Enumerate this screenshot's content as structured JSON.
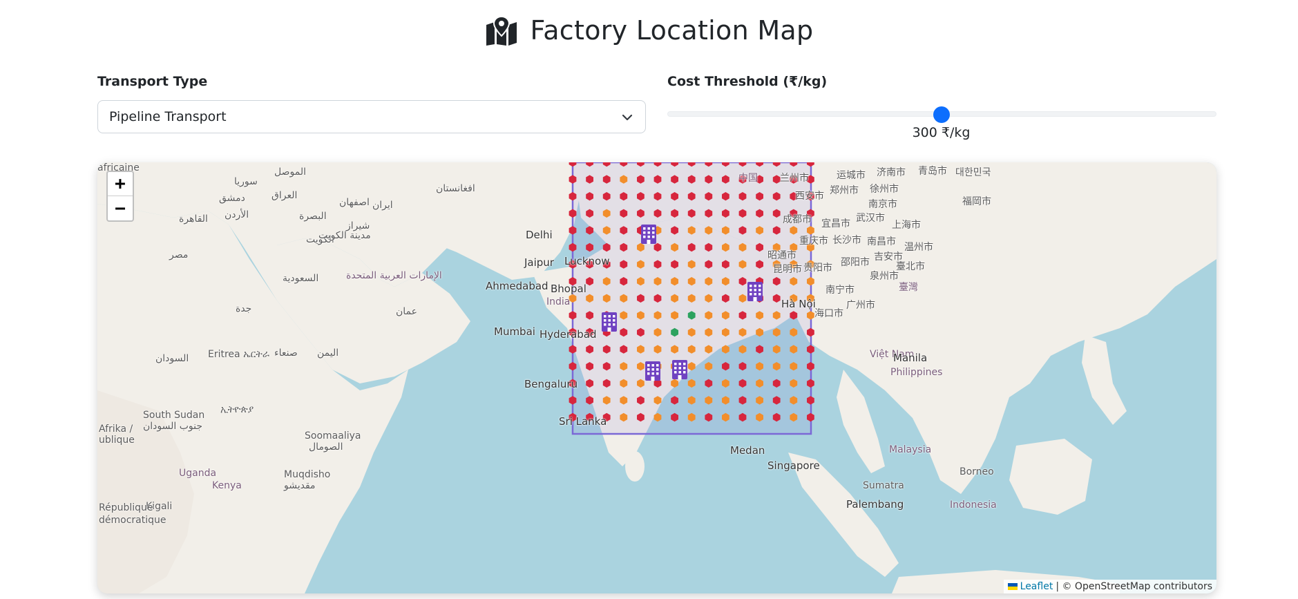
{
  "header": {
    "title": "Factory Location Map",
    "icon": "map-location-icon"
  },
  "controls": {
    "transport_label": "Transport Type",
    "transport_value": "Pipeline Transport",
    "cost_label": "Cost Threshold (₹/kg)",
    "cost_value_text": "300 ₹/kg",
    "cost_value": 300
  },
  "map": {
    "zoom_in": "+",
    "zoom_out": "−",
    "attribution_leaflet": "Leaflet",
    "attribution_rest": "| © OpenStreetMap contributors",
    "colors": {
      "water": "#aad3df",
      "land": "#f2efe9",
      "boundary": "#7b68d6",
      "high_cost": "#d7263d",
      "medium_cost": "#f28e2b",
      "low_cost": "#2ca25f",
      "factory": "#6f42c1"
    },
    "labels": [
      {
        "text": "中国"
      },
      {
        "text": "兰州市"
      },
      {
        "text": "运城市"
      },
      {
        "text": "济南市"
      },
      {
        "text": "青岛市"
      },
      {
        "text": "대한민국"
      },
      {
        "text": "西安市"
      },
      {
        "text": "郑州市"
      },
      {
        "text": "徐州市"
      },
      {
        "text": "南京市"
      },
      {
        "text": "福岡市"
      },
      {
        "text": "成都市"
      },
      {
        "text": "宜昌市"
      },
      {
        "text": "武汉市"
      },
      {
        "text": "上海市"
      },
      {
        "text": "重庆市"
      },
      {
        "text": "长沙市"
      },
      {
        "text": "南昌市"
      },
      {
        "text": "温州市"
      },
      {
        "text": "昭通市"
      },
      {
        "text": "邵阳市"
      },
      {
        "text": "吉安市"
      },
      {
        "text": "昆明市"
      },
      {
        "text": "贵阳市"
      },
      {
        "text": "臺北市"
      },
      {
        "text": "泉州市"
      },
      {
        "text": "南宁市"
      },
      {
        "text": "臺灣"
      },
      {
        "text": "广州市"
      },
      {
        "text": "Hà Nội"
      },
      {
        "text": "海口市"
      },
      {
        "text": "Việt Nam"
      },
      {
        "text": "Manila"
      },
      {
        "text": "Philippines"
      },
      {
        "text": "Medan"
      },
      {
        "text": "Singapore"
      },
      {
        "text": "Malaysia"
      },
      {
        "text": "Borneo"
      },
      {
        "text": "Sumatra"
      },
      {
        "text": "Palembang"
      },
      {
        "text": "Indonesia"
      },
      {
        "text": "Ahmedabad"
      },
      {
        "text": "Bhopal"
      },
      {
        "text": "India"
      },
      {
        "text": "Hyderabad"
      },
      {
        "text": "Jaipur"
      },
      {
        "text": "Lucknow"
      },
      {
        "text": "Delhi"
      },
      {
        "text": "Mumbai"
      },
      {
        "text": "Bengaluru"
      },
      {
        "text": "Sri Lanka"
      },
      {
        "text": "الموصل"
      },
      {
        "text": "سوريا"
      },
      {
        "text": "العراق"
      },
      {
        "text": "دمشق"
      },
      {
        "text": "الأردن"
      },
      {
        "text": "القاهرة"
      },
      {
        "text": "مصر"
      },
      {
        "text": "البصرة"
      },
      {
        "text": "الكويت"
      },
      {
        "text": "مدينة الكويت"
      },
      {
        "text": "شيراز"
      },
      {
        "text": "ایران"
      },
      {
        "text": "اصفهان"
      },
      {
        "text": "افغانستان"
      },
      {
        "text": "الإمارات العربية المتحدة"
      },
      {
        "text": "السعودية"
      },
      {
        "text": "عمان"
      },
      {
        "text": "جدة"
      },
      {
        "text": "صنعاء"
      },
      {
        "text": "اليمن"
      },
      {
        "text": "السودان"
      },
      {
        "text": "Eritrea ኤርትራ"
      },
      {
        "text": "South Sudan"
      },
      {
        "text": "جنوب السودان"
      },
      {
        "text": "ኢትዮጵያ"
      },
      {
        "text": "Soomaaliya"
      },
      {
        "text": "الصومال"
      },
      {
        "text": "Muqdisho"
      },
      {
        "text": "مقديشو"
      },
      {
        "text": "Uganda"
      },
      {
        "text": "Kenya"
      },
      {
        "text": "Kigali"
      },
      {
        "text": "République"
      },
      {
        "text": "démocratique"
      },
      {
        "text": "Afrika /"
      },
      {
        "text": "ublique"
      },
      {
        "text": "africaine"
      }
    ]
  },
  "factories": [
    {
      "name": "factory-delhi"
    },
    {
      "name": "factory-kolkata"
    },
    {
      "name": "factory-mumbai"
    },
    {
      "name": "factory-bengaluru-west"
    },
    {
      "name": "factory-bengaluru-east"
    }
  ]
}
